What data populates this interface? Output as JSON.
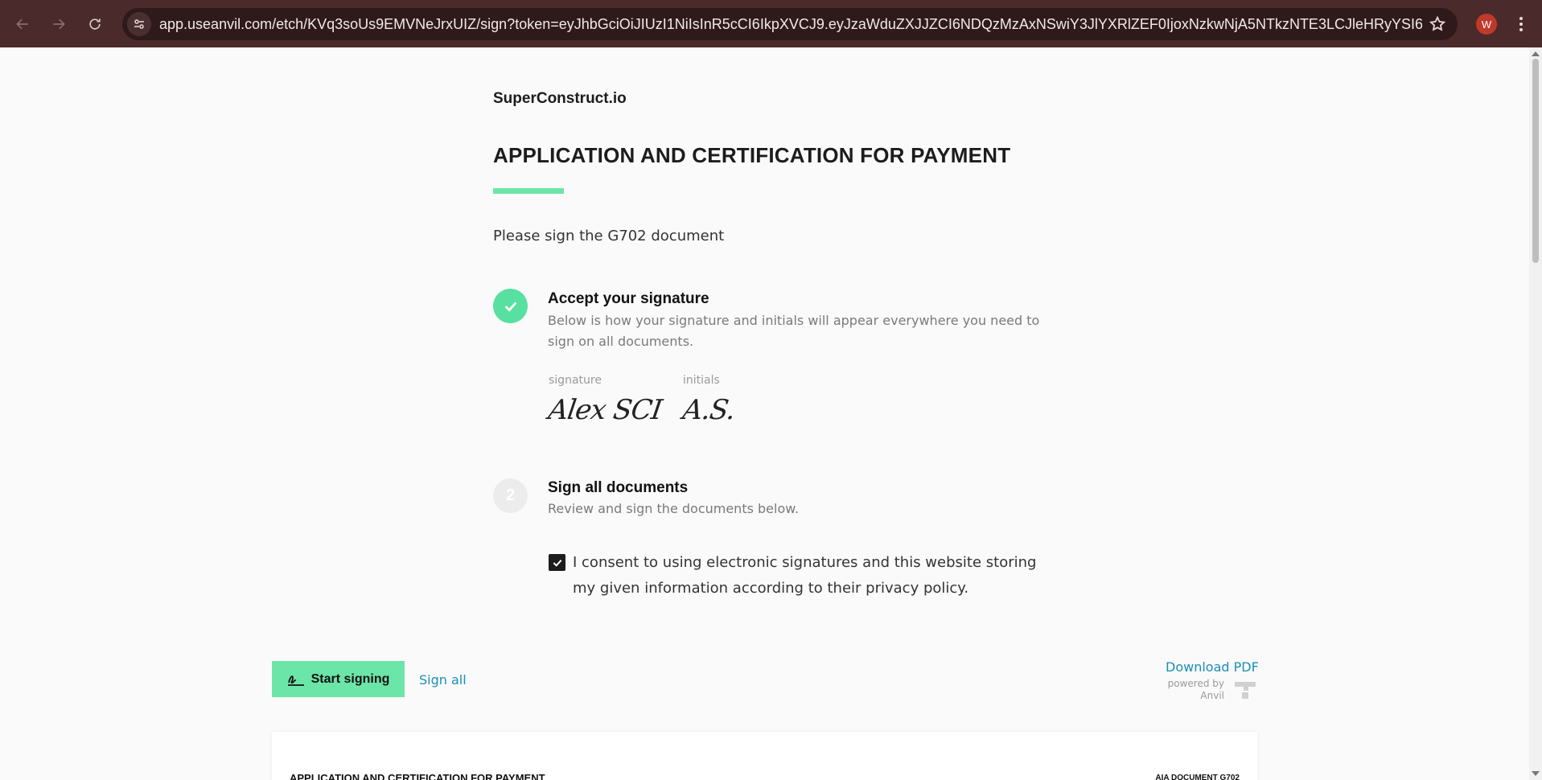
{
  "browser": {
    "url": "app.useanvil.com/etch/KVq3soUs9EMVNeJrxUIZ/sign?token=eyJhbGciOiJIUzI1NiIsInR5cCI6IkpXVCJ9.eyJzaWduZXJJZCI6NDQzMzAxNSwiY3JlYXRlZEF0IjoxNzkwNjA5NTkzNTE3LCJleHRyYSI6IlZwR1ciLCJp...",
    "profile_initial": "W",
    "icons": [
      "back-arrow-icon",
      "forward-arrow-icon",
      "reload-icon",
      "site-settings-icon",
      "star-icon",
      "kebab-menu-icon"
    ]
  },
  "page": {
    "company": "SuperConstruct.io",
    "title": "APPLICATION AND CERTIFICATION FOR PAYMENT",
    "intro": "Please sign the G702 document",
    "accent_color": "#6ce5a8",
    "link_color": "#1a8fb6"
  },
  "steps": [
    {
      "state": "complete",
      "title": "Accept your signature",
      "description": "Below is how your signature and initials will appear everywhere you need to sign on all documents."
    },
    {
      "state": "pending",
      "number": "2",
      "title": "Sign all documents",
      "description": "Review and sign the documents below."
    }
  ],
  "signature": {
    "signature_label": "signature",
    "signature_value": "Alex SCI",
    "initials_label": "initials",
    "initials_value": "A.S."
  },
  "consent": {
    "checked": true,
    "text": "I consent to using electronic signatures and this website storing my given information according to their privacy policy."
  },
  "actions": {
    "start_signing": "Start signing",
    "sign_all": "Sign all",
    "download_pdf": "Download PDF",
    "powered_by": "powered by",
    "brand": "Anvil"
  },
  "document": {
    "title": "APPLICATION AND CERTIFICATION FOR PAYMENT",
    "tag": "AIA DOCUMENT G702"
  }
}
